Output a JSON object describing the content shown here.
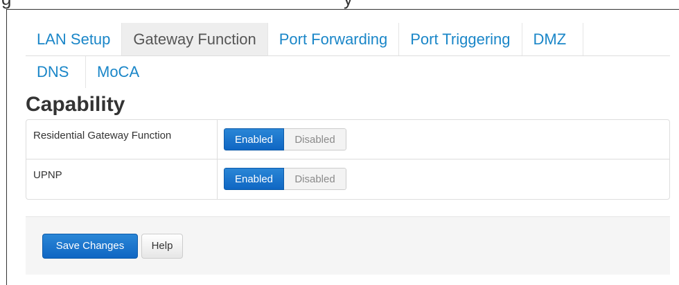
{
  "header_fragment": {
    "left_char": "g",
    "right_char": "y"
  },
  "tabs": {
    "row1": [
      {
        "label": "LAN Setup",
        "active": false
      },
      {
        "label": "Gateway Function",
        "active": true
      },
      {
        "label": "Port Forwarding",
        "active": false
      },
      {
        "label": "Port Triggering",
        "active": false
      },
      {
        "label": "DMZ",
        "active": false
      }
    ],
    "row2": [
      {
        "label": "DNS",
        "active": false
      },
      {
        "label": "MoCA",
        "active": false
      }
    ]
  },
  "section": {
    "title": "Capability"
  },
  "capabilities": [
    {
      "label": "Residential Gateway Function",
      "enabled_label": "Enabled",
      "disabled_label": "Disabled",
      "value": "Enabled"
    },
    {
      "label": "UPNP",
      "enabled_label": "Enabled",
      "disabled_label": "Disabled",
      "value": "Enabled"
    }
  ],
  "footer": {
    "save_label": "Save Changes",
    "help_label": "Help"
  },
  "colors": {
    "link": "#1a86c8",
    "primary": "#0f66c3",
    "active_tab_bg": "#eeeeee"
  }
}
